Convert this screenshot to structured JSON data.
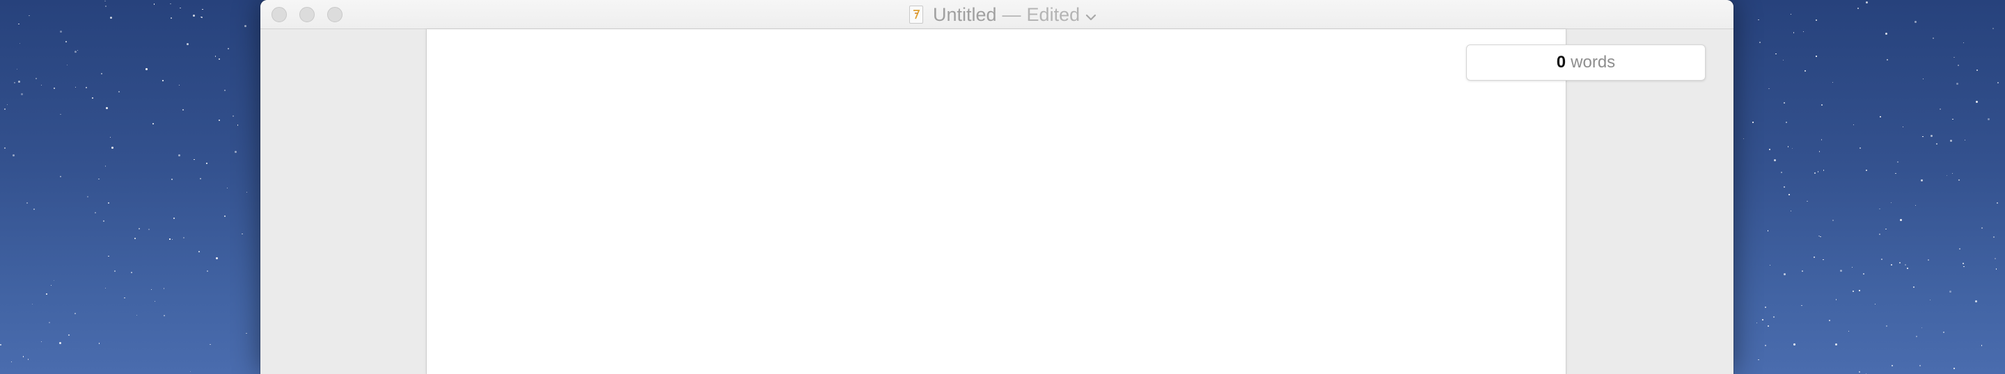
{
  "desktop": {
    "background_top": "#27427c",
    "background_bottom": "#4a6cae"
  },
  "window": {
    "title": "Untitled",
    "title_separator": "—",
    "title_status": "Edited",
    "document_icon": "pages-document-icon",
    "traffic_lights": [
      "close",
      "minimize",
      "zoom"
    ]
  },
  "word_count": {
    "value": "0",
    "label": "words"
  },
  "colors": {
    "sidebar_gray": "#ebebeb",
    "page_white": "#ffffff",
    "title_text": "#a0a0a0"
  }
}
